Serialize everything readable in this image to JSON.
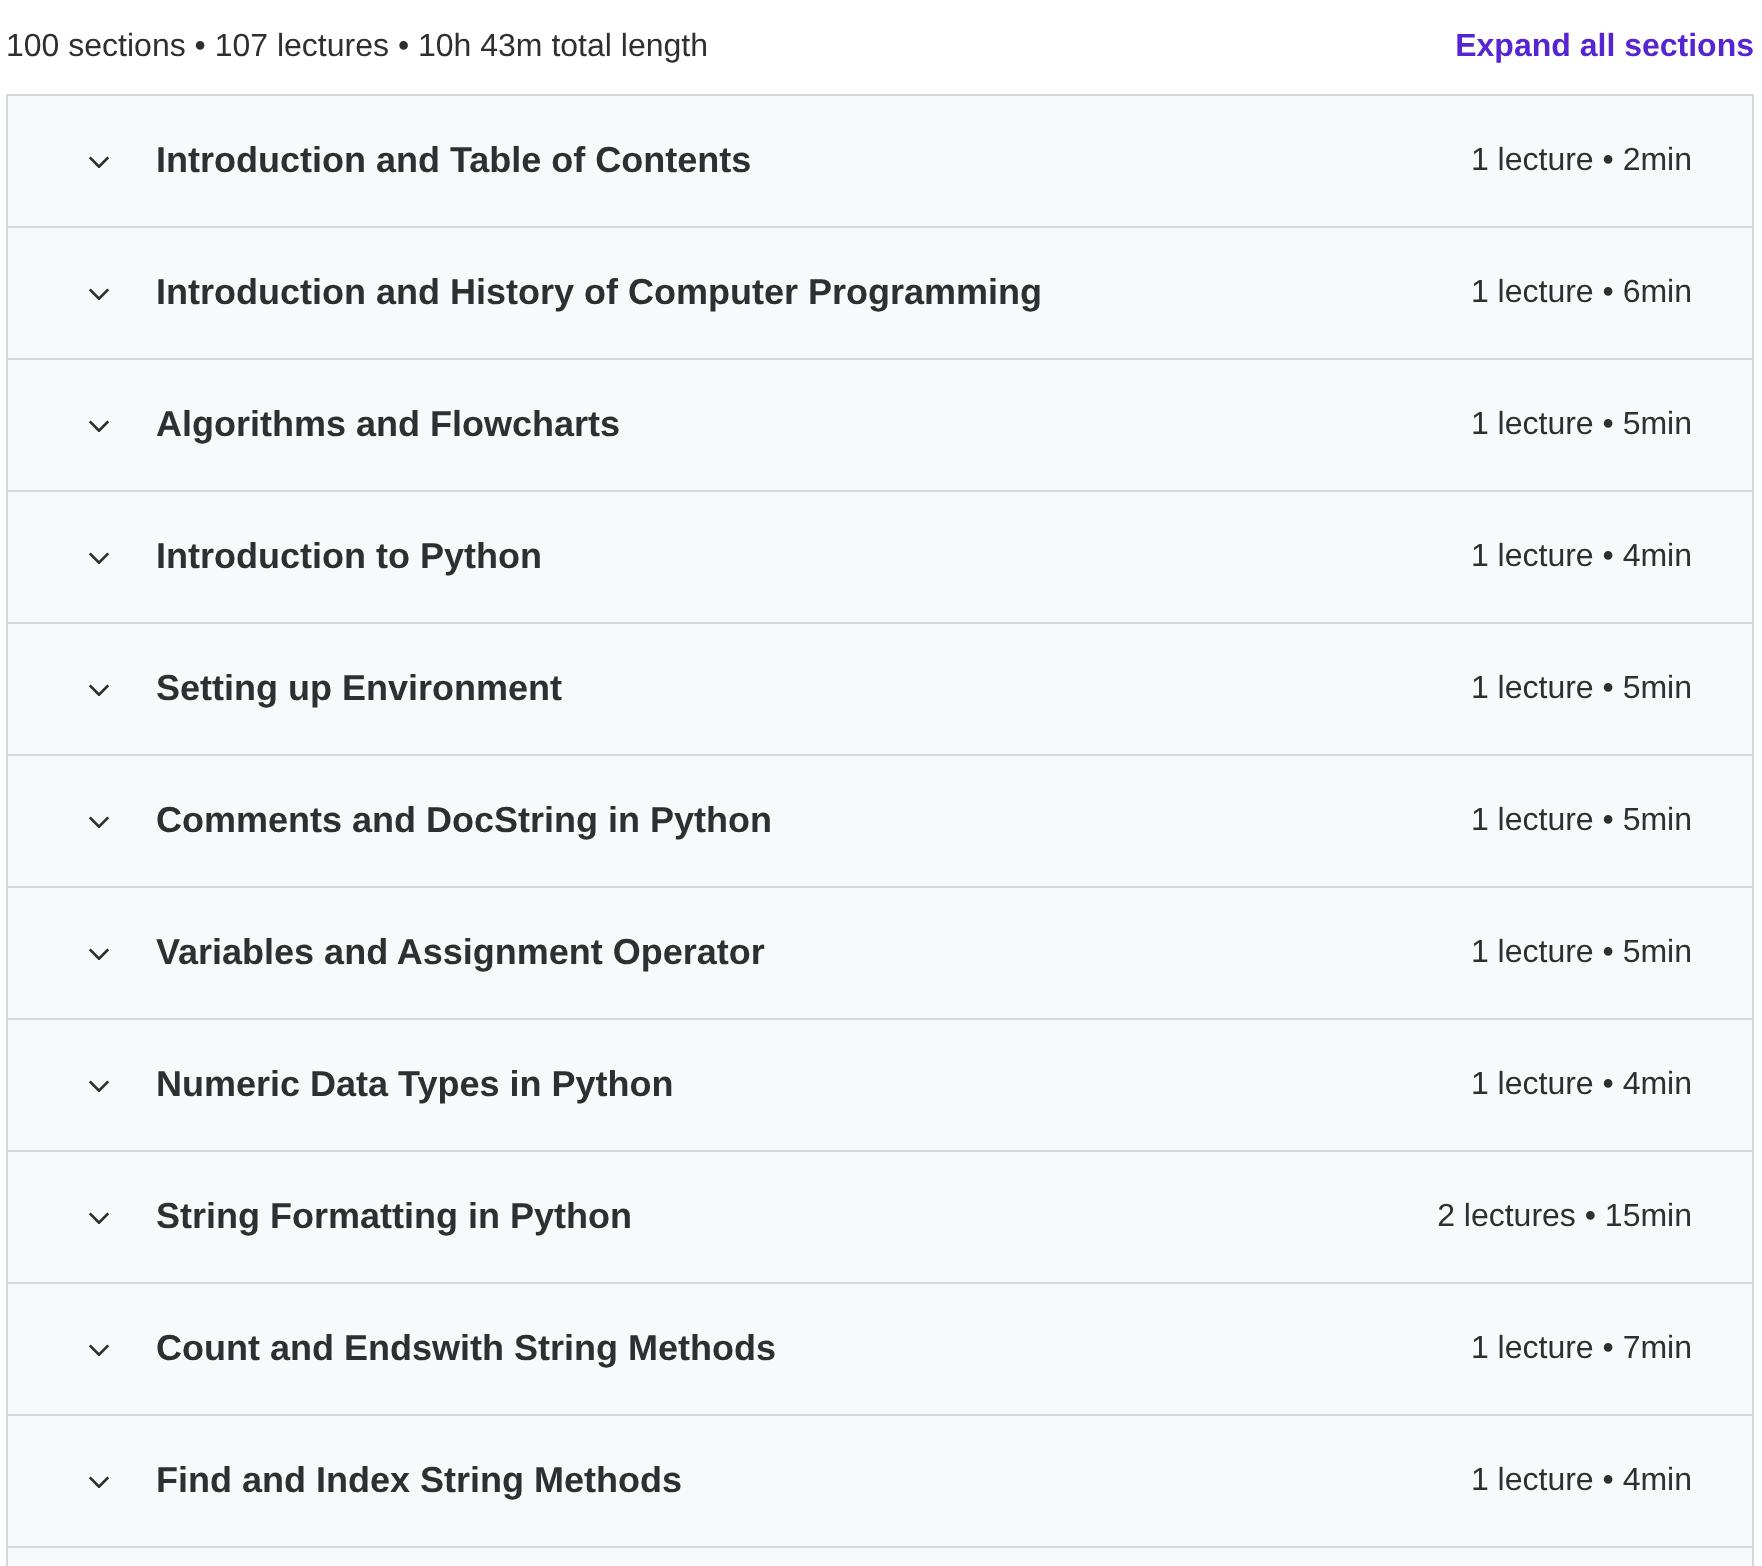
{
  "summary": "100 sections • 107 lectures • 10h 43m total length",
  "expand_all": "Expand all sections",
  "sections": [
    {
      "title": "Introduction and Table of Contents",
      "meta": "1 lecture • 2min",
      "expanded": false
    },
    {
      "title": "Introduction and History of Computer Programming",
      "meta": "1 lecture • 6min",
      "expanded": false
    },
    {
      "title": "Algorithms and Flowcharts",
      "meta": "1 lecture • 5min",
      "expanded": false
    },
    {
      "title": "Introduction to Python",
      "meta": "1 lecture • 4min",
      "expanded": false
    },
    {
      "title": "Setting up Environment",
      "meta": "1 lecture • 5min",
      "expanded": false
    },
    {
      "title": "Comments and DocString in Python",
      "meta": "1 lecture • 5min",
      "expanded": false
    },
    {
      "title": "Variables and Assignment Operator",
      "meta": "1 lecture • 5min",
      "expanded": false
    },
    {
      "title": "Numeric Data Types in Python",
      "meta": "1 lecture • 4min",
      "expanded": false
    },
    {
      "title": "String Formatting in Python",
      "meta": "2 lectures • 15min",
      "expanded": false
    },
    {
      "title": "Count and Endswith String Methods",
      "meta": "1 lecture • 7min",
      "expanded": false
    },
    {
      "title": "Find and Index String Methods",
      "meta": "1 lecture • 4min",
      "expanded": false
    }
  ]
}
